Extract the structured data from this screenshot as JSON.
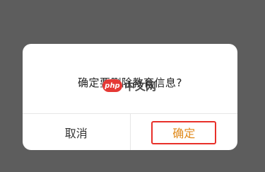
{
  "dialog": {
    "message": "确定要删除教育信息?",
    "cancel_label": "取消",
    "confirm_label": "确定"
  },
  "watermark": {
    "badge": "php",
    "text": "中文网"
  },
  "colors": {
    "overlay": "#5d5d5d",
    "dialog_background": "#ffffff",
    "confirm_text": "#e08a1c",
    "highlight_border": "#e8302a",
    "watermark_badge": "#e53935"
  }
}
